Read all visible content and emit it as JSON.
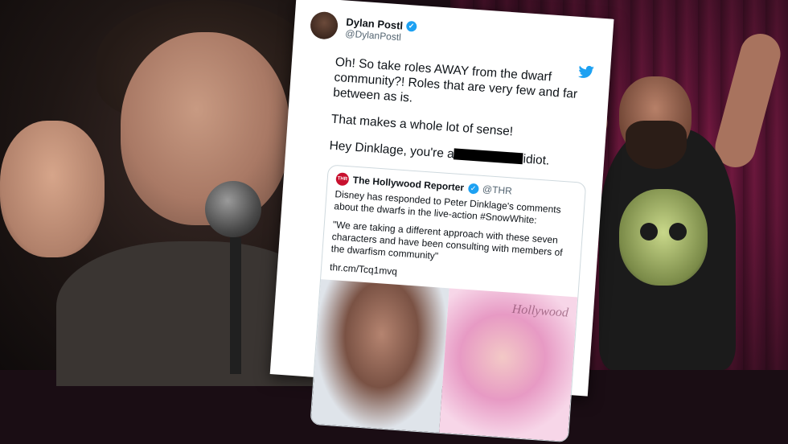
{
  "tweet": {
    "display_name": "Dylan Postl",
    "handle": "@DylanPostl",
    "paragraphs": [
      "Oh! So take roles AWAY from the dwarf community?! Roles that are very few and far between as is.",
      "That makes a whole lot of sense!"
    ],
    "last_line_prefix": "Hey Dinklage, you're a",
    "last_line_suffix": "idiot."
  },
  "quoted_tweet": {
    "logo_text": "THR",
    "display_name": "The Hollywood Reporter",
    "handle": "@THR",
    "text": "Disney has responded to Peter Dinklage's comments about the dwarfs in the live-action #SnowWhite:",
    "quote": "\"We are taking a different approach with these seven characters and have been consulting with members of the dwarfism community\"",
    "link": "thr.cm/Tcq1mvq",
    "image_brand": "Hollywood"
  },
  "colors": {
    "twitter_blue": "#1da1f2",
    "curtain_red": "#7a1a44"
  },
  "icons": [
    "verified-badge-icon",
    "twitter-bird-icon"
  ]
}
